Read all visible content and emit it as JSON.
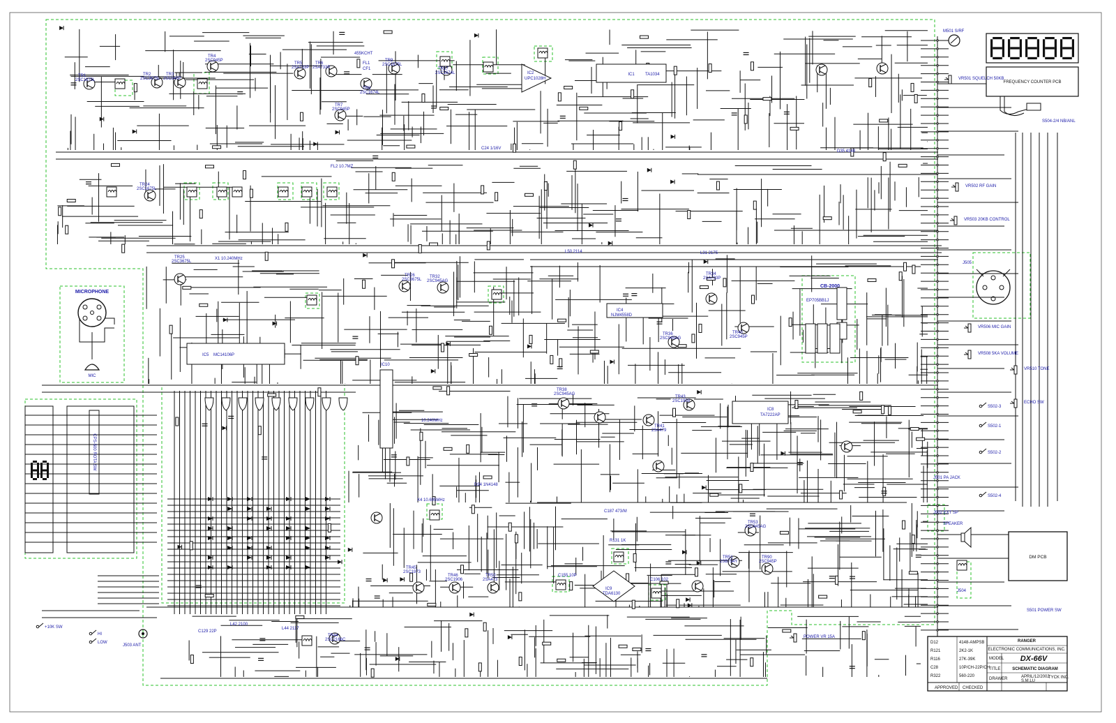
{
  "title_block": {
    "company_line1": "RANGER",
    "company_line2": "ELECTRONIC COMMUNICATIONS, INC.",
    "model_label": "MODEL",
    "model": "DX-66V",
    "title_label": "TITLE",
    "title": "SCHEMATIC DIAGRAM",
    "approved_label": "APPROVED",
    "checked_label": "CHECKED",
    "drawer_label": "DRAWER",
    "drawer": "S.M.LU",
    "date": "APRIL/12/2002",
    "pcb_label": "TYCK INC.",
    "notes": [
      {
        "ref": "D12",
        "value": "4148-AMPSB"
      },
      {
        "ref": "R121",
        "value": "2K2-1K"
      },
      {
        "ref": "R116",
        "value": "27K-39K"
      },
      {
        "ref": "C28",
        "value": "10P/CH-22P/CH"
      },
      {
        "ref": "R322",
        "value": "560-220"
      }
    ]
  },
  "blocks": {
    "frequency_counter": "FREQUENCY COUNTER PCB",
    "freq_display": "88888",
    "microphone": "MICROPHONE",
    "mic": "MIC",
    "dm_pcb": "DM PCB",
    "cb_unit": "CB-2000",
    "power_sw": "S501 POWER SW",
    "speaker": "SPEAKER",
    "ant": "J503 ANT",
    "display_module": "88",
    "channel_switch": "CPS-500 ROTA SW"
  },
  "ics": [
    {
      "ref": "IC1",
      "part": "TA1034"
    },
    {
      "ref": "IC2",
      "part": "UPC1028H"
    },
    {
      "ref": "IC4",
      "part": "NJM4558D"
    },
    {
      "ref": "IC5",
      "part": "MC14106P"
    },
    {
      "ref": "IC8",
      "part": "TA7222AP"
    },
    {
      "ref": "IC9",
      "part": "TDA6130"
    },
    {
      "ref": "IC10",
      "part": "LM1-5C"
    }
  ],
  "transistors": [
    {
      "ref": "TR1",
      "part": "2SC1675L"
    },
    {
      "ref": "TR2",
      "part": "2SC3675L"
    },
    {
      "ref": "TR3",
      "part": "2SC945P"
    },
    {
      "ref": "TR4",
      "part": "2SC945P"
    },
    {
      "ref": "TR5",
      "part": "2SA733P"
    },
    {
      "ref": "TR6",
      "part": "2SA733P"
    },
    {
      "ref": "TR7",
      "part": "2SC945P"
    },
    {
      "ref": "TR8",
      "part": "2SC1674L"
    },
    {
      "ref": "TR9",
      "part": "2SC1675L"
    },
    {
      "ref": "TR17",
      "part": "2SC1674L"
    },
    {
      "ref": "TR24",
      "part": "2SC1675L"
    },
    {
      "ref": "TR25",
      "part": "2SC3675L"
    },
    {
      "ref": "TR26",
      "part": "2SC3675L"
    },
    {
      "ref": "TR32",
      "part": "2SC945AG"
    },
    {
      "ref": "TR34",
      "part": "2SA733P"
    },
    {
      "ref": "TR36",
      "part": "2SC945AG"
    },
    {
      "ref": "TR38",
      "part": "2SC945AG"
    },
    {
      "ref": "TR40",
      "part": "2SC945P"
    },
    {
      "ref": "TR41",
      "part": "2SA479"
    },
    {
      "ref": "TR43",
      "part": "2SC1959"
    },
    {
      "ref": "TR44",
      "part": "2SC2166C"
    },
    {
      "ref": "TR45",
      "part": "2SC1973"
    },
    {
      "ref": "TR46",
      "part": "2SC1906"
    },
    {
      "ref": "TR50",
      "part": "2SA473"
    },
    {
      "ref": "TR51",
      "part": "2SB754Y"
    },
    {
      "ref": "TR53",
      "part": "2SC945AG"
    },
    {
      "ref": "TR90",
      "part": "2SC945P"
    }
  ],
  "switches": [
    {
      "ref": "S502-3",
      "label": "S502-3"
    },
    {
      "ref": "S502-1",
      "label": "S502-1"
    },
    {
      "ref": "S502-2",
      "label": "S502-2"
    },
    {
      "ref": "S502-4",
      "label": "S502-4"
    },
    {
      "ref": "S504",
      "label": "S504-2/4 NB/ANL"
    },
    {
      "ref": "HIGH",
      "label": "HI"
    },
    {
      "ref": "LOW",
      "label": "LOW"
    },
    {
      "ref": "10K SW",
      "label": "+10K SW"
    }
  ],
  "controls": [
    {
      "ref": "VR501",
      "label": "VR501 SQUELCH 50KB"
    },
    {
      "ref": "VR502",
      "label": "VR502 RF GAIN"
    },
    {
      "ref": "VR503",
      "label": "VR503 20KB CONTROL"
    },
    {
      "ref": "VR506",
      "label": "VR506 MIC GAIN"
    },
    {
      "ref": "VR508",
      "label": "VR508 5KA VOLUME"
    },
    {
      "ref": "VR510",
      "label": "VR510 TONE"
    },
    {
      "ref": "VR511",
      "label": "ECHO SW"
    },
    {
      "ref": "POWER_VR",
      "label": "POWER VR 15A"
    }
  ],
  "connectors": [
    {
      "ref": "J501",
      "label": "J501 PA JACK"
    },
    {
      "ref": "J502",
      "label": "J502 EXT SP"
    },
    {
      "ref": "J504",
      "label": "J504"
    },
    {
      "ref": "J505",
      "label": "J505"
    },
    {
      "ref": "M501",
      "label": "M501 S/RF"
    }
  ],
  "misc_labels": [
    "455KCHT",
    "CF1",
    "FL1",
    "FL2 10.7MZ",
    "X1 10.240MHz",
    "X4 10.695MHz",
    "10.240MHz",
    "EP705BB1J",
    "D94 1N4148",
    "C24 1/16V",
    "D35 4148",
    "C187 473/M",
    "R131 1K",
    "C106 102",
    "C155 10P",
    "C129 22P",
    "L42 2100",
    "L44 2117",
    "L50 2114",
    "L31 2175",
    "L32 RFC",
    "L33",
    "D64 1N4148",
    "D70 MDZ-8V"
  ]
}
